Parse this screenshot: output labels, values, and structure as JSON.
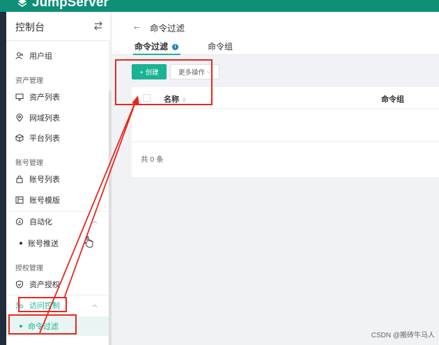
{
  "app": {
    "name": "JumpServer"
  },
  "sidebar": {
    "title": "控制台",
    "items": [
      {
        "label": "用户组",
        "icon": "user-group-icon"
      },
      {
        "group": "资产管理"
      },
      {
        "label": "资产列表",
        "icon": "desktop-icon"
      },
      {
        "label": "网域列表",
        "icon": "location-icon"
      },
      {
        "label": "平台列表",
        "icon": "cube-icon"
      },
      {
        "group": "账号管理"
      },
      {
        "label": "账号列表",
        "icon": "lock-icon"
      },
      {
        "label": "账号模版",
        "icon": "template-icon"
      },
      {
        "label": "自动化",
        "icon": "automation-icon"
      },
      {
        "label": "账号推送",
        "sub": true
      },
      {
        "group": "授权管理"
      },
      {
        "label": "资产授权",
        "icon": "shield-icon"
      },
      {
        "label": "访问控制",
        "icon": "access-control-icon",
        "active": true
      },
      {
        "label": "命令过滤",
        "sub": true,
        "active": true
      }
    ]
  },
  "header": {
    "back_arrow": "←",
    "title": "命令过滤",
    "tabs": [
      {
        "label": "命令过滤",
        "active": true,
        "info": "i"
      },
      {
        "label": "命令组"
      }
    ]
  },
  "toolbar": {
    "create_label": "+ 创建",
    "more_label": "更多操作",
    "more_caret": "⌵"
  },
  "table": {
    "columns": [
      "名称",
      "命令组"
    ],
    "sort_glyph": "⇕",
    "rows": [],
    "total_text": "共 0 条"
  },
  "watermark": "CSDN @搬砖牛马人",
  "colors": {
    "brand": "#0e8f77",
    "accent": "#1ab394",
    "annotation": "#e8261c"
  }
}
